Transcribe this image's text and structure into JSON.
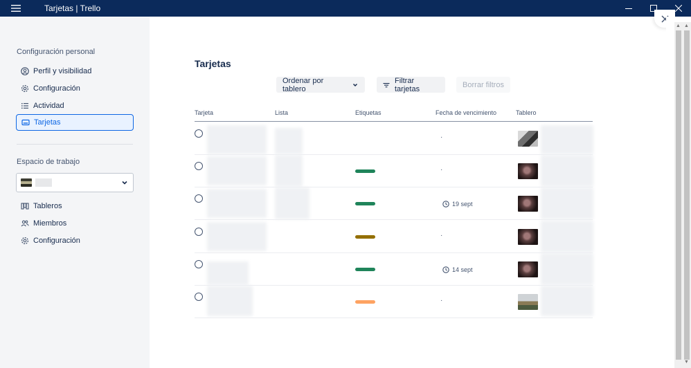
{
  "window": {
    "title": "Tarjetas | Trello"
  },
  "sidebar": {
    "personal_title": "Configuración personal",
    "personal_items": [
      {
        "label": "Perfil y visibilidad",
        "icon": "user-circle-icon"
      },
      {
        "label": "Configuración",
        "icon": "gear-icon"
      },
      {
        "label": "Actividad",
        "icon": "list-icon"
      },
      {
        "label": "Tarjetas",
        "icon": "card-icon",
        "active": true
      }
    ],
    "workspace_title": "Espacio de trabajo",
    "workspace_items": [
      {
        "label": "Tableros",
        "icon": "boards-icon"
      },
      {
        "label": "Miembros",
        "icon": "members-icon"
      },
      {
        "label": "Configuración",
        "icon": "gear-icon"
      }
    ]
  },
  "main": {
    "title": "Tarjetas",
    "sort_button": "Ordenar por tablero",
    "filter_button": "Filtrar tarjetas",
    "clear_button": "Borrar filtros",
    "columns": [
      "Tarjeta",
      "Lista",
      "Etiquetas",
      "Fecha de vencimiento",
      "Tablero"
    ],
    "rows": [
      {
        "label_color": "",
        "due": "·",
        "board_thumb": "office"
      },
      {
        "label_color": "#1f845a",
        "due": "·",
        "board_thumb": "dark"
      },
      {
        "label_color": "#1f845a",
        "due": "19 sept",
        "board_thumb": "dark"
      },
      {
        "label_color": "#946f00",
        "due": "·",
        "board_thumb": "dark"
      },
      {
        "label_color": "#1f845a",
        "due": "14 sept",
        "board_thumb": "dark"
      },
      {
        "label_color": "#fea362",
        "due": "·",
        "board_thumb": "landscape"
      }
    ]
  }
}
